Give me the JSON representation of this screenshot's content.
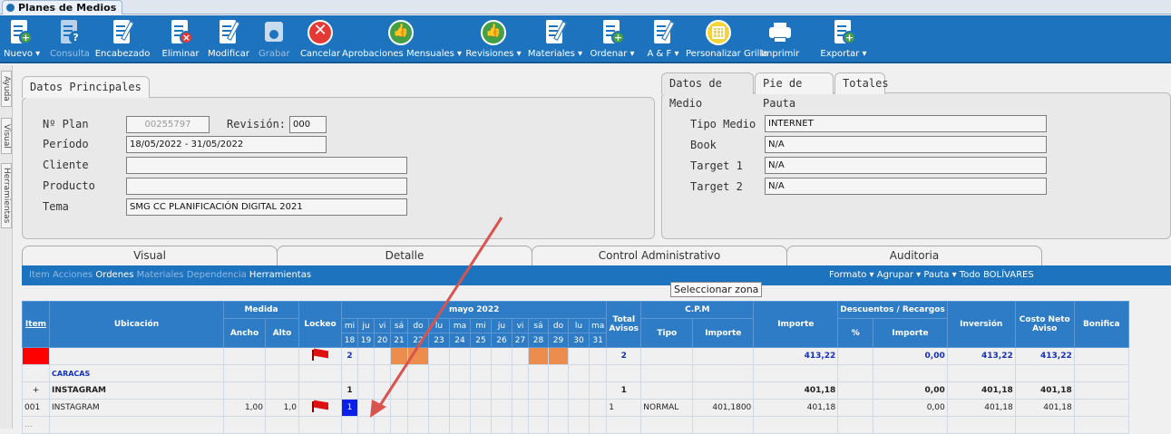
{
  "window": {
    "title": "Planes de Medios"
  },
  "toolbar": {
    "items": [
      {
        "label": "Nuevo ▾",
        "icon": "new-doc-icon",
        "enabled": true
      },
      {
        "label": "Consulta",
        "icon": "query-doc-icon",
        "enabled": false
      },
      {
        "label": "Encabezado",
        "icon": "edit-doc-icon",
        "enabled": true
      },
      {
        "label": "Eliminar",
        "icon": "delete-doc-icon",
        "enabled": true
      },
      {
        "label": "Modificar",
        "icon": "modify-doc-icon",
        "enabled": true
      },
      {
        "label": "Grabar",
        "icon": "save-icon",
        "enabled": false
      },
      {
        "label": "Cancelar",
        "icon": "cancel-icon",
        "enabled": true
      },
      {
        "label": "Aprobaciones Mensuales ▾",
        "icon": "thumbs-up-icon",
        "enabled": true
      },
      {
        "label": "Revisiones ▾",
        "icon": "thumbs-up-icon",
        "enabled": true
      },
      {
        "label": "Materiales ▾",
        "icon": "materials-doc-icon",
        "enabled": true
      },
      {
        "label": "Ordenar ▾",
        "icon": "order-doc-icon",
        "enabled": true
      },
      {
        "label": "A & F ▾",
        "icon": "af-doc-icon",
        "enabled": true
      },
      {
        "label": "Personalizar Grilla",
        "icon": "grid-icon",
        "enabled": true
      },
      {
        "label": "Imprimir",
        "icon": "printer-icon",
        "enabled": true
      },
      {
        "label": "Exportar ▾",
        "icon": "export-doc-icon",
        "enabled": true
      }
    ]
  },
  "sidetabs": [
    "Ayuda",
    "Visual",
    "Herramientas"
  ],
  "principal": {
    "tab": "Datos Principales",
    "nplan_label": "Nº Plan",
    "nplan": "00255797",
    "revision_label": "Revisión:",
    "revision": "000",
    "periodo_label": "Período",
    "periodo": "18/05/2022 - 31/05/2022",
    "cliente_label": "Cliente",
    "cliente": "",
    "producto_label": "Producto",
    "producto": "",
    "tema_label": "Tema",
    "tema": "SMG CC PLANIFICACIÓN DIGITAL 2021"
  },
  "medio": {
    "tabs": [
      "Datos de Medio",
      "Pie de Pauta",
      "Totales"
    ],
    "tipo_label": "Tipo Medio",
    "tipo": "INTERNET",
    "book_label": "Book",
    "book": "N/A",
    "t1_label": "Target 1",
    "t1": "N/A",
    "t2_label": "Target 2",
    "t2": "N/A"
  },
  "main_tabs": [
    "Visual",
    "Detalle",
    "Control Administrativo",
    "Auditoria"
  ],
  "subbar": {
    "left_dim1": "Item",
    "left_dim2": "Acciones",
    "ordenes": "Ordenes",
    "materiales": "Materiales",
    "dependencia": "Dependencia",
    "herramientas": "Herramientas",
    "right": "Formato ▾  Agrupar ▾  Pauta ▾  Todo  BOLÍVARES"
  },
  "tooltip": "Seleccionar zona",
  "grid": {
    "headers": {
      "item": "Item",
      "ubicacion": "Ubicación",
      "medida": "Medida",
      "ancho": "Ancho",
      "alto": "Alto",
      "lockeo": "Lockeo",
      "month": "mayo 2022",
      "total_avisos": "Total Avisos",
      "cpm": "C.P.M",
      "tipo": "Tipo",
      "importe_cpm": "Importe",
      "importe": "Importe",
      "desc": "Descuentos / Recargos",
      "pct": "%",
      "desc_importe": "Importe",
      "inversion": "Inversión",
      "costo": "Costo Neto Aviso",
      "bonif": "Bonifica"
    },
    "days": [
      "mi",
      "ju",
      "vi",
      "sá",
      "do",
      "lu",
      "ma",
      "mi",
      "ju",
      "vi",
      "sá",
      "do",
      "lu",
      "ma"
    ],
    "dates": [
      "18",
      "19",
      "20",
      "21",
      "22",
      "23",
      "24",
      "25",
      "26",
      "27",
      "28",
      "29",
      "30",
      "31"
    ],
    "totals_row": {
      "count": "2",
      "avisos": "2",
      "importe": "413,22",
      "desc": "0,00",
      "inversion": "413,22",
      "costo": "413,22"
    },
    "caracas": "CARACAS",
    "group_row": {
      "expander": "+",
      "name": "INSTAGRAM",
      "count": "1",
      "avisos": "1",
      "importe": "401,18",
      "desc": "0,00",
      "inversion": "401,18",
      "costo": "401,18"
    },
    "detail_row": {
      "item": "001",
      "name": "INSTAGRAM",
      "ancho": "1,00",
      "alto": "1,0",
      "cell": "1",
      "avisos": "1",
      "tipo": "NORMAL",
      "cpm_importe": "401,1800",
      "importe": "401,18",
      "desc": "0,00",
      "inversion": "401,18",
      "costo": "401,18"
    },
    "last_row": "..."
  },
  "colors": {
    "accent": "#1e73be",
    "highlight_orange": "#ec8c4d",
    "selected_blue": "#0a1fe8",
    "alert_red": "#ff0000",
    "arrow": "#d9534f"
  }
}
